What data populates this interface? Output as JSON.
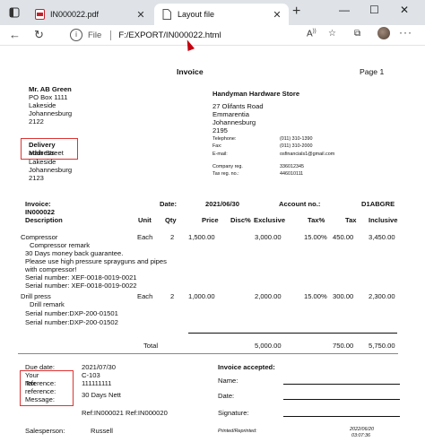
{
  "browser": {
    "tabs": [
      {
        "title": "IN000022.pdf",
        "active": false
      },
      {
        "title": "Layout file",
        "active": true
      }
    ],
    "address": {
      "scheme_label": "File",
      "url": "F:/EXPORT/IN000022.html"
    },
    "icons": [
      "back-icon",
      "forward-icon",
      "refresh-icon",
      "info-icon",
      "read-aloud-icon",
      "favorite-add-icon",
      "collections-icon",
      "favorites-icon",
      "profile-avatar",
      "more-menu-icon",
      "minimize-icon",
      "maximize-icon",
      "close-icon",
      "new-tab-icon"
    ]
  },
  "invoice": {
    "title": "Invoice",
    "page": "Page 1",
    "customer": {
      "name": "Mr. AB Green",
      "lines": [
        "PO Box 1111",
        "Lakeside",
        "Johannesburg",
        "2122"
      ]
    },
    "delivery": {
      "label": "Delivery",
      "label2": "address",
      "overlap_text": "Main Street",
      "lines": [
        "Lakeside",
        "Johannesburg",
        "2123"
      ]
    },
    "store": {
      "name": "Handyman Hardware Store",
      "lines": [
        "27 Olifants Road",
        "Emmarentia",
        "Johannesburg",
        "2195"
      ],
      "telephone_label": "Telephone:",
      "telephone": "(011) 310-1390",
      "fax_label": "Fax:",
      "fax": "(011) 310-2000",
      "email_label": "E-mail:",
      "email": "osfinancials1@gmail.com",
      "company_reg_label": "Company reg.",
      "company_reg": "336012345",
      "vat_label": "Tax reg. no.:",
      "vat": "446010111"
    },
    "meta": {
      "invoice_label": "Invoice:",
      "invoice_no": "IN000022",
      "date_label": "Date:",
      "date": "2021/06/30",
      "account_label": "Account no.:",
      "account": "D1ABGRE"
    },
    "headers": {
      "description": "Description",
      "unit": "Unit",
      "qty": "Qty",
      "price": "Price",
      "disc": "Disc%",
      "exclusive": "Exclusive",
      "tax_pct": "Tax%",
      "tax": "Tax",
      "inclusive": "Inclusive"
    },
    "items": [
      {
        "description": "Compressor",
        "unit": "Each",
        "qty": "2",
        "price": "1,500.00",
        "exclusive": "3,000.00",
        "tax_pct": "15.00%",
        "tax": "450.00",
        "inclusive": "3,450.00",
        "notes": [
          "Compressor remark",
          "30 Days money back guarantee.",
          "Please use high pressure sprayguns and pipes",
          "with compressor!",
          "Serial number: XEF-0018-0019-0021",
          "Serial number: XEF-0018-0019-0022"
        ]
      },
      {
        "description": "Drill press",
        "unit": "Each",
        "qty": "2",
        "price": "1,000.00",
        "exclusive": "2,000.00",
        "tax_pct": "15.00%",
        "tax": "300.00",
        "inclusive": "2,300.00",
        "notes": [
          "Drill remark",
          "Serial number:DXP-200-01501",
          "Serial number:DXP-200-01502"
        ]
      }
    ],
    "totals": {
      "label": "Total",
      "exclusive": "5,000.00",
      "tax": "750.00",
      "inclusive": "5,750.00"
    },
    "footer": {
      "due_label": "Due date:",
      "due": "2021/07/30",
      "ref_label_a": "Your",
      "ref_label_b": "reference:",
      "ref": "C-103",
      "tax_label": "Tax",
      "tax_val": "111111111",
      "msg_label": "Message:",
      "msg": "30 Days Nett",
      "refs": "Ref:IN000021 Ref:IN000020",
      "salesperson_label": "Salesperson:",
      "salesperson": "Russell",
      "printed": "Printed/Reprinted:",
      "print_date": "2022/06/20",
      "print_time": "03:07:36"
    },
    "acceptance": {
      "title": "Invoice accepted:",
      "name": "Name:",
      "date": "Date:",
      "signature": "Signature:"
    }
  }
}
